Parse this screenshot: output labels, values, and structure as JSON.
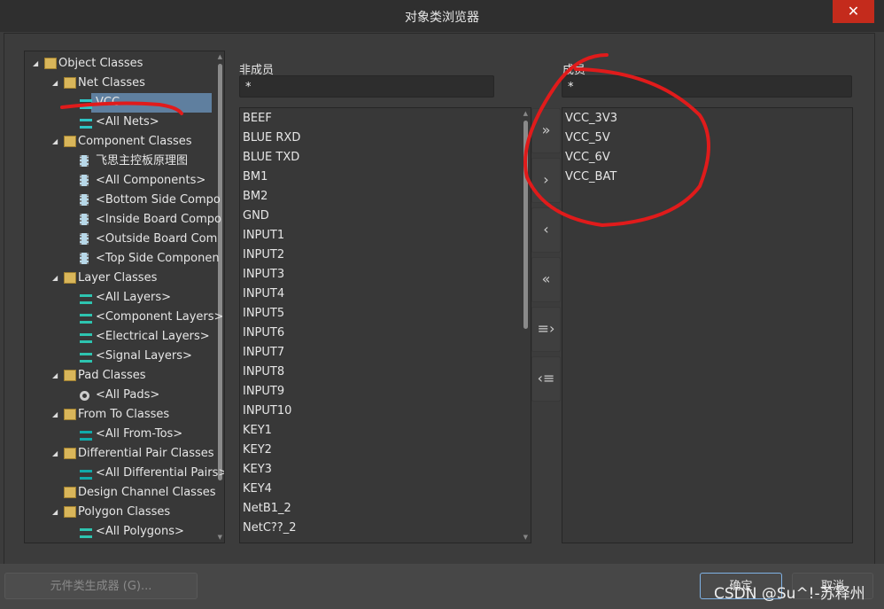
{
  "window": {
    "title": "对象类浏览器",
    "close_icon": "close-icon"
  },
  "tree": {
    "items": [
      {
        "label": "Object Classes",
        "level": 0,
        "expanded": true,
        "icon": "folder-object-icon"
      },
      {
        "label": "Net Classes",
        "level": 1,
        "expanded": true,
        "icon": "folder-net-icon"
      },
      {
        "label": "VCC",
        "level": 2,
        "icon": "net-icon",
        "selected": true
      },
      {
        "label": "<All Nets>",
        "level": 2,
        "icon": "net-icon"
      },
      {
        "label": "Component Classes",
        "level": 1,
        "expanded": true,
        "icon": "folder-component-icon"
      },
      {
        "label": "飞思主控板原理图",
        "level": 2,
        "icon": "component-icon"
      },
      {
        "label": "<All Components>",
        "level": 2,
        "icon": "component-icon"
      },
      {
        "label": "<Bottom Side Compo",
        "level": 2,
        "icon": "component-icon"
      },
      {
        "label": "<Inside Board Compo",
        "level": 2,
        "icon": "component-icon"
      },
      {
        "label": "<Outside Board Com",
        "level": 2,
        "icon": "component-icon"
      },
      {
        "label": "<Top Side Componen",
        "level": 2,
        "icon": "component-icon"
      },
      {
        "label": "Layer Classes",
        "level": 1,
        "expanded": true,
        "icon": "folder-layer-icon"
      },
      {
        "label": "<All Layers>",
        "level": 2,
        "icon": "layer-icon"
      },
      {
        "label": "<Component Layers>",
        "level": 2,
        "icon": "layer-icon"
      },
      {
        "label": "<Electrical Layers>",
        "level": 2,
        "icon": "layer-icon"
      },
      {
        "label": "<Signal Layers>",
        "level": 2,
        "icon": "layer-icon"
      },
      {
        "label": "Pad Classes",
        "level": 1,
        "expanded": true,
        "icon": "folder-pad-icon"
      },
      {
        "label": "<All Pads>",
        "level": 2,
        "icon": "pad-icon"
      },
      {
        "label": "From To Classes",
        "level": 1,
        "expanded": true,
        "icon": "folder-fromto-icon"
      },
      {
        "label": "<All From-Tos>",
        "level": 2,
        "icon": "fromto-icon"
      },
      {
        "label": "Differential Pair Classes",
        "level": 1,
        "expanded": true,
        "icon": "folder-diffpair-icon"
      },
      {
        "label": "<All Differential Pairs>",
        "level": 2,
        "icon": "fromto-icon"
      },
      {
        "label": "Design Channel Classes",
        "level": 1,
        "expanded": false,
        "icon": "folder-layer-icon"
      },
      {
        "label": "Polygon Classes",
        "level": 1,
        "expanded": true,
        "icon": "folder-object-icon"
      },
      {
        "label": "<All Polygons>",
        "level": 2,
        "icon": "layer-icon"
      }
    ]
  },
  "non_members": {
    "label": "非成员",
    "filter": "*",
    "items": [
      "BEEF",
      "BLUE RXD",
      "BLUE TXD",
      "BM1",
      "BM2",
      "GND",
      "INPUT1",
      "INPUT2",
      "INPUT3",
      "INPUT4",
      "INPUT5",
      "INPUT6",
      "INPUT7",
      "INPUT8",
      "INPUT9",
      "INPUT10",
      "KEY1",
      "KEY2",
      "KEY3",
      "KEY4",
      "NetB1_2",
      "NetC??_2"
    ]
  },
  "members": {
    "label": "成员",
    "filter": "*",
    "items": [
      "VCC_3V3",
      "VCC_5V",
      "VCC_6V",
      "VCC_BAT"
    ]
  },
  "move_buttons": [
    {
      "name": "add-all-button",
      "glyph": "»"
    },
    {
      "name": "add-selected-button",
      "glyph": "›"
    },
    {
      "name": "remove-selected-button",
      "glyph": "‹"
    },
    {
      "name": "remove-all-button",
      "glyph": "«"
    },
    {
      "name": "add-filtered-button",
      "glyph": "≡›"
    },
    {
      "name": "remove-filtered-button",
      "glyph": "‹≡"
    }
  ],
  "footer": {
    "generator_label": "元件类生成器 (G)...",
    "ok_label": "确定",
    "cancel_label": "取消",
    "watermark": "CSDN @Su^!-苏释州"
  },
  "colors": {
    "selection": "#5f7f9f",
    "close": "#c42b1c",
    "annotation": "#e01b1b",
    "ok_border": "#7fb2e5"
  }
}
